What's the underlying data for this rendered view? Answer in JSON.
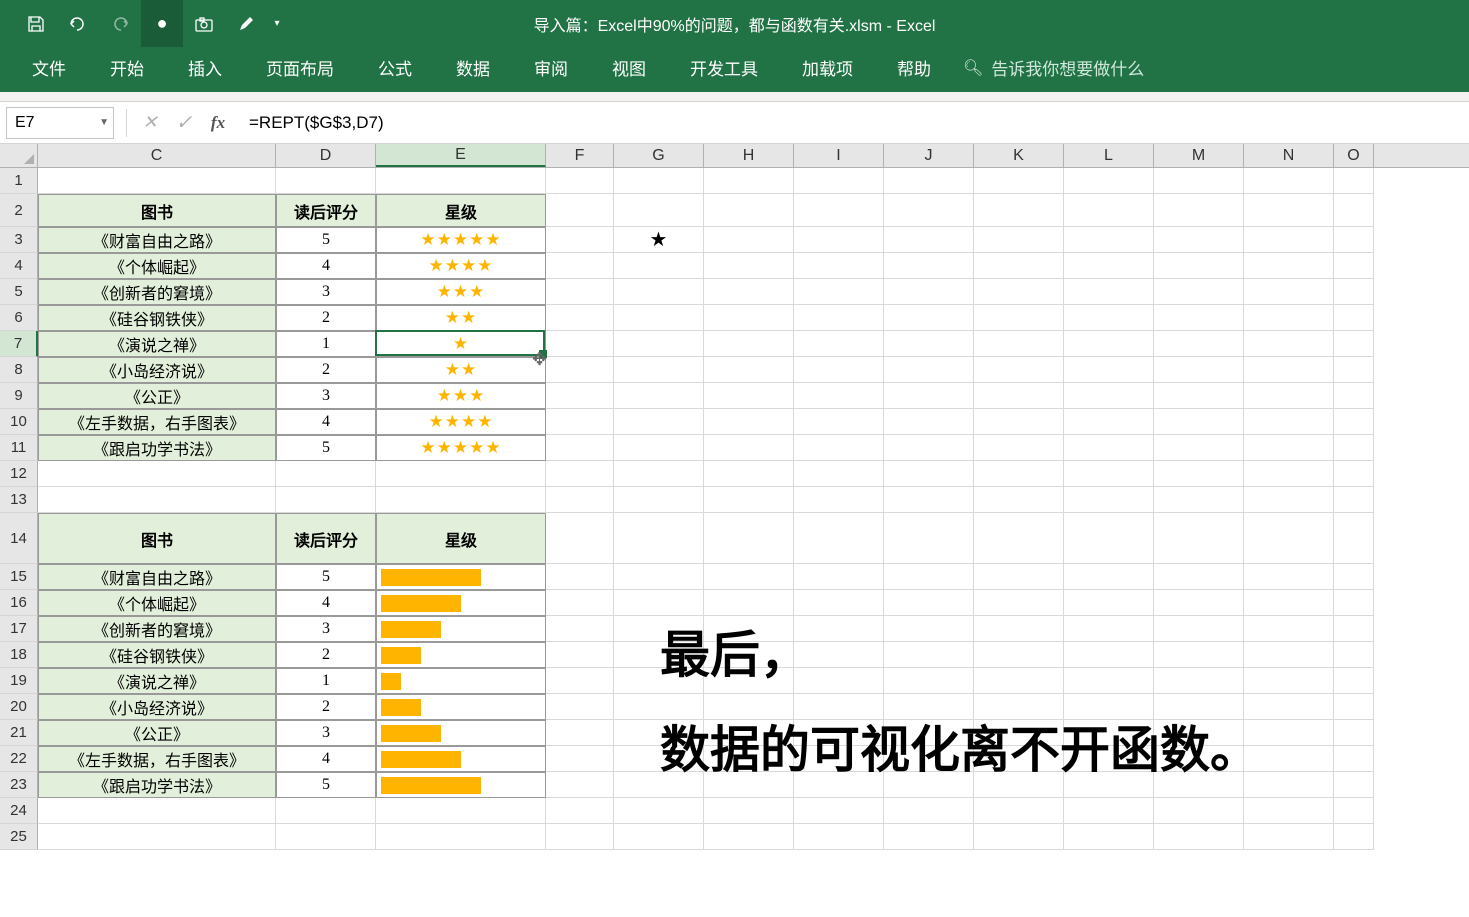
{
  "titlebar": {
    "title": "导入篇：Excel中90%的问题，都与函数有关.xlsm  -  Excel"
  },
  "ribbon": {
    "tabs": [
      "文件",
      "开始",
      "插入",
      "页面布局",
      "公式",
      "数据",
      "审阅",
      "视图",
      "开发工具",
      "加载项",
      "帮助"
    ],
    "search_hint": "告诉我你想要做什么"
  },
  "formula_bar": {
    "cell_ref": "E7",
    "fx_label": "fx",
    "formula": "=REPT($G$3,D7)"
  },
  "columns": [
    "C",
    "D",
    "E",
    "F",
    "G",
    "H",
    "I",
    "J",
    "K",
    "L",
    "M",
    "N",
    "O"
  ],
  "rows": [
    1,
    2,
    3,
    4,
    5,
    6,
    7,
    8,
    9,
    10,
    11,
    12,
    13,
    14,
    15,
    16,
    17,
    18,
    19,
    20,
    21,
    22,
    23,
    24,
    25
  ],
  "active_col": "E",
  "active_row": 7,
  "table1": {
    "headers": [
      "图书",
      "读后评分",
      "星级"
    ],
    "rows": [
      {
        "book": "《财富自由之路》",
        "score": "5",
        "stars": "★★★★★"
      },
      {
        "book": "《个体崛起》",
        "score": "4",
        "stars": "★★★★"
      },
      {
        "book": "《创新者的窘境》",
        "score": "3",
        "stars": "★★★"
      },
      {
        "book": "《硅谷钢铁侠》",
        "score": "2",
        "stars": "★★"
      },
      {
        "book": "《演说之禅》",
        "score": "1",
        "stars": "★"
      },
      {
        "book": "《小岛经济说》",
        "score": "2",
        "stars": "★★"
      },
      {
        "book": "《公正》",
        "score": "3",
        "stars": "★★★"
      },
      {
        "book": "《左手数据，右手图表》",
        "score": "4",
        "stars": "★★★★"
      },
      {
        "book": "《跟启功学书法》",
        "score": "5",
        "stars": "★★★★★"
      }
    ]
  },
  "g3_value": "★",
  "table2": {
    "headers": [
      "图书",
      "读后评分",
      "星级"
    ],
    "rows": [
      {
        "book": "《财富自由之路》",
        "score": "5",
        "bar": 100
      },
      {
        "book": "《个体崛起》",
        "score": "4",
        "bar": 80
      },
      {
        "book": "《创新者的窘境》",
        "score": "3",
        "bar": 60
      },
      {
        "book": "《硅谷钢铁侠》",
        "score": "2",
        "bar": 40
      },
      {
        "book": "《演说之禅》",
        "score": "1",
        "bar": 20
      },
      {
        "book": "《小岛经济说》",
        "score": "2",
        "bar": 40
      },
      {
        "book": "《公正》",
        "score": "3",
        "bar": 60
      },
      {
        "book": "《左手数据，右手图表》",
        "score": "4",
        "bar": 80
      },
      {
        "book": "《跟启功学书法》",
        "score": "5",
        "bar": 100
      }
    ]
  },
  "overlay": {
    "line1": "最后，",
    "line2": "数据的可视化离不开函数。"
  }
}
